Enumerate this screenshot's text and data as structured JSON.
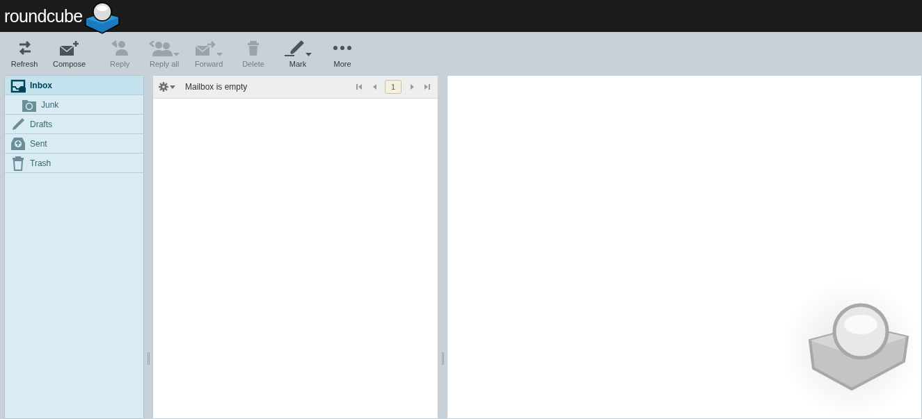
{
  "header": {
    "logo_text": "roundcube"
  },
  "toolbar": [
    {
      "label": "Refresh",
      "disabled": false,
      "has_menu": false
    },
    {
      "label": "Compose",
      "disabled": false,
      "has_menu": false
    },
    {
      "label": "Reply",
      "disabled": true,
      "has_menu": false
    },
    {
      "label": "Reply all",
      "disabled": true,
      "has_menu": true
    },
    {
      "label": "Forward",
      "disabled": true,
      "has_menu": true
    },
    {
      "label": "Delete",
      "disabled": true,
      "has_menu": false
    },
    {
      "label": "Mark",
      "disabled": false,
      "has_menu": true
    },
    {
      "label": "More",
      "disabled": false,
      "has_menu": false
    }
  ],
  "folders": [
    {
      "label": "Inbox",
      "selected": true,
      "children": [
        {
          "label": "Junk",
          "selected": false
        }
      ]
    },
    {
      "label": "Drafts",
      "selected": false
    },
    {
      "label": "Sent",
      "selected": false
    },
    {
      "label": "Trash",
      "selected": false
    }
  ],
  "message_list": {
    "status": "Mailbox is empty",
    "page": "1"
  }
}
